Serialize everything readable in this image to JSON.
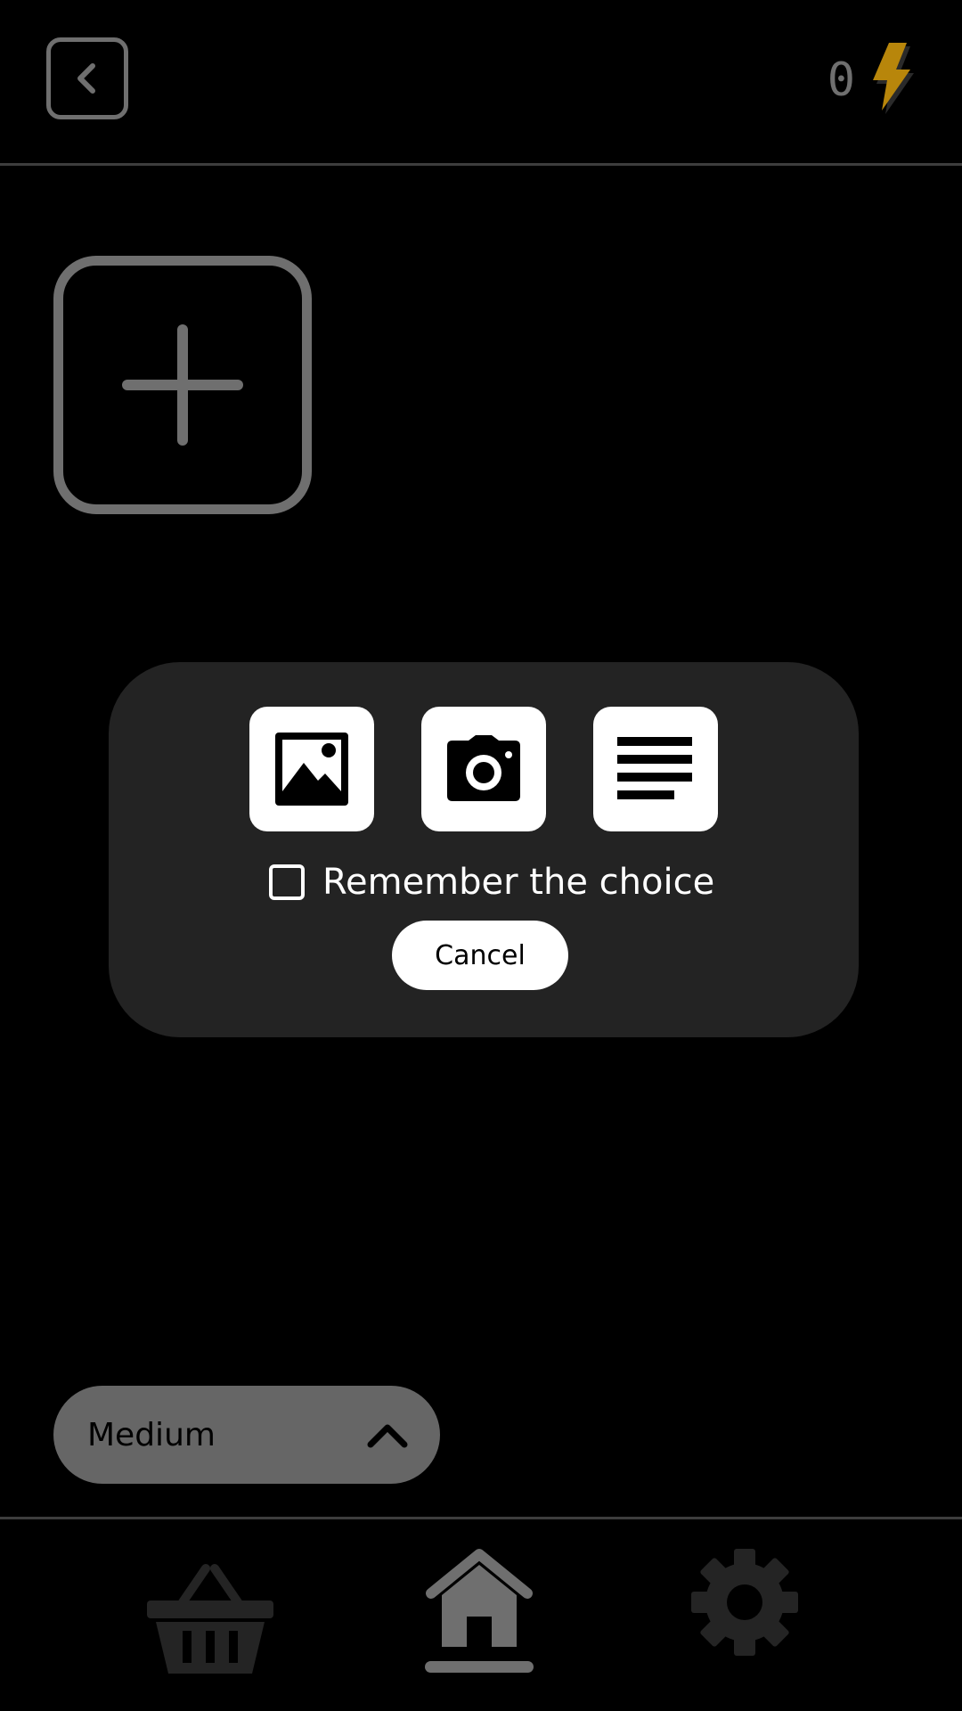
{
  "header": {
    "credits": "0",
    "back_icon": "chevron-left-icon",
    "credit_icon": "lightning-bolt-icon"
  },
  "dialog": {
    "options": [
      {
        "name": "gallery",
        "icon": "image-icon"
      },
      {
        "name": "camera",
        "icon": "camera-icon"
      },
      {
        "name": "text",
        "icon": "text-lines-icon"
      }
    ],
    "remember_label": "Remember the choice",
    "remember_checked": false,
    "cancel_label": "Cancel"
  },
  "difficulty": {
    "selected": "Medium",
    "chevron": "chevron-up-icon"
  },
  "bottom_nav": {
    "items": [
      {
        "name": "shop",
        "icon": "basket-icon"
      },
      {
        "name": "home",
        "icon": "home-icon",
        "active": true
      },
      {
        "name": "settings",
        "icon": "gear-icon"
      }
    ]
  },
  "colors": {
    "background": "#000000",
    "dialog": "#232323",
    "muted": "#6f6f6f",
    "bolt": "#b8860b"
  }
}
